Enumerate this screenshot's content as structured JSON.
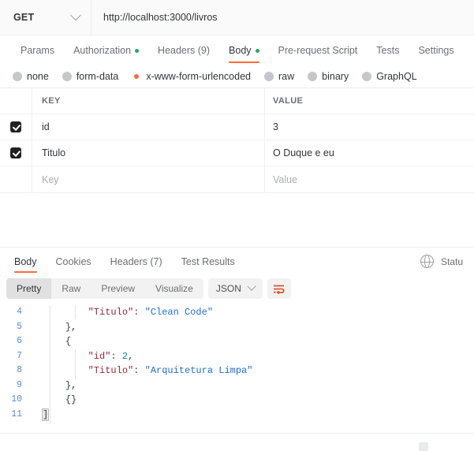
{
  "request": {
    "method": "GET",
    "method_icon": "chevron-down-icon",
    "url": "http://localhost:3000/livros",
    "tabs": [
      {
        "label": "Params",
        "dot": false,
        "active": false
      },
      {
        "label": "Authorization",
        "dot": true,
        "active": false
      },
      {
        "label": "Headers (9)",
        "dot": false,
        "active": false
      },
      {
        "label": "Body",
        "dot": true,
        "active": true
      },
      {
        "label": "Pre-request Script",
        "dot": false,
        "active": false
      },
      {
        "label": "Tests",
        "dot": false,
        "active": false
      },
      {
        "label": "Settings",
        "dot": false,
        "active": false
      }
    ],
    "body_types": [
      {
        "label": "none",
        "selected": false
      },
      {
        "label": "form-data",
        "selected": false
      },
      {
        "label": "x-www-form-urlencoded",
        "selected": true
      },
      {
        "label": "raw",
        "selected": false
      },
      {
        "label": "binary",
        "selected": false
      },
      {
        "label": "GraphQL",
        "selected": false
      }
    ],
    "table": {
      "headers": {
        "key": "KEY",
        "value": "VALUE"
      },
      "rows": [
        {
          "checked": true,
          "key": "id",
          "value": "3"
        },
        {
          "checked": true,
          "key": "Titulo",
          "value": "O Duque e eu"
        }
      ],
      "placeholder_row": {
        "checked": false,
        "key": "Key",
        "value": "Value"
      }
    }
  },
  "response": {
    "tabs": [
      {
        "label": "Body",
        "active": true
      },
      {
        "label": "Cookies",
        "active": false
      },
      {
        "label": "Headers (7)",
        "active": false
      },
      {
        "label": "Test Results",
        "active": false
      }
    ],
    "globe_icon": "globe-icon",
    "status_text": "Statu",
    "format_tabs": [
      {
        "label": "Pretty",
        "active": true
      },
      {
        "label": "Raw",
        "active": false
      },
      {
        "label": "Preview",
        "active": false
      },
      {
        "label": "Visualize",
        "active": false
      }
    ],
    "language": "JSON",
    "language_icon": "chevron-down-icon",
    "wrap_icon": "wrap-lines-icon"
  },
  "code": {
    "lines": [
      {
        "num": "4",
        "indent": 8,
        "tokens": [
          {
            "t": "k",
            "v": "\"Titulo\""
          },
          {
            "t": "p",
            "v": ": "
          },
          {
            "t": "s",
            "v": "\"Clean Code\""
          }
        ]
      },
      {
        "num": "5",
        "indent": 4,
        "tokens": [
          {
            "t": "p",
            "v": "},"
          }
        ]
      },
      {
        "num": "6",
        "indent": 4,
        "tokens": [
          {
            "t": "p",
            "v": "{"
          }
        ]
      },
      {
        "num": "7",
        "indent": 8,
        "tokens": [
          {
            "t": "k",
            "v": "\"id\""
          },
          {
            "t": "p",
            "v": ": "
          },
          {
            "t": "n",
            "v": "2"
          },
          {
            "t": "p",
            "v": ","
          }
        ]
      },
      {
        "num": "8",
        "indent": 8,
        "tokens": [
          {
            "t": "k",
            "v": "\"Titulo\""
          },
          {
            "t": "p",
            "v": ": "
          },
          {
            "t": "s",
            "v": "\"Arquitetura Limpa\""
          }
        ]
      },
      {
        "num": "9",
        "indent": 4,
        "tokens": [
          {
            "t": "p",
            "v": "},"
          }
        ]
      },
      {
        "num": "10",
        "indent": 4,
        "tokens": [
          {
            "t": "p",
            "v": "{}"
          }
        ]
      },
      {
        "num": "11",
        "indent": 0,
        "tokens": [
          {
            "t": "p",
            "v": "]",
            "sel": true
          }
        ]
      }
    ]
  },
  "colors": {
    "accent": "#ff6c37",
    "dot_green": "#1aaf62",
    "json_key": "#8e2a38",
    "json_string": "#1f6fd0",
    "json_number": "#0f8a7e",
    "line_number": "#5b8bd0"
  }
}
